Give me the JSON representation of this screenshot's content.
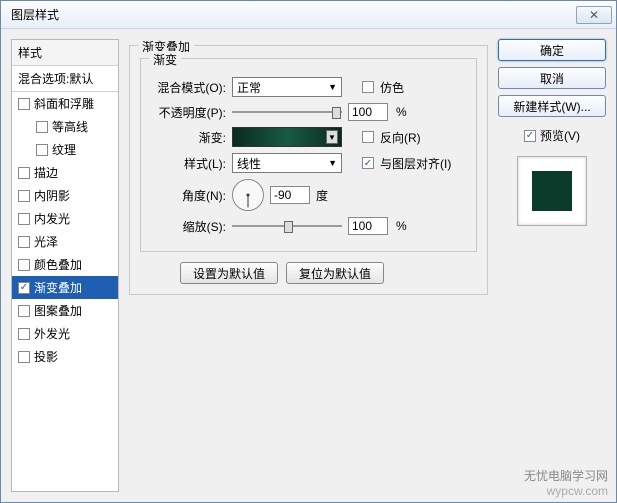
{
  "title": "图层样式",
  "close_glyph": "✕",
  "left": {
    "header": "样式",
    "blending": "混合选项:默认",
    "items": [
      {
        "label": "斜面和浮雕",
        "checked": false,
        "indent": false
      },
      {
        "label": "等高线",
        "checked": false,
        "indent": true
      },
      {
        "label": "纹理",
        "checked": false,
        "indent": true
      },
      {
        "label": "描边",
        "checked": false,
        "indent": false
      },
      {
        "label": "内阴影",
        "checked": false,
        "indent": false
      },
      {
        "label": "内发光",
        "checked": false,
        "indent": false
      },
      {
        "label": "光泽",
        "checked": false,
        "indent": false
      },
      {
        "label": "颜色叠加",
        "checked": false,
        "indent": false
      },
      {
        "label": "渐变叠加",
        "checked": true,
        "indent": false,
        "selected": true
      },
      {
        "label": "图案叠加",
        "checked": false,
        "indent": false
      },
      {
        "label": "外发光",
        "checked": false,
        "indent": false
      },
      {
        "label": "投影",
        "checked": false,
        "indent": false
      }
    ]
  },
  "center": {
    "group_title": "渐变叠加",
    "inner_title": "渐变",
    "blend_mode_label": "混合模式(O):",
    "blend_mode_value": "正常",
    "dither_label": "仿色",
    "opacity_label": "不透明度(P):",
    "opacity_value": "100",
    "gradient_label": "渐变:",
    "reverse_label": "反向(R)",
    "style_label": "样式(L):",
    "style_value": "线性",
    "align_label": "与图层对齐(I)",
    "angle_label": "角度(N):",
    "angle_value": "-90",
    "angle_unit": "度",
    "scale_label": "缩放(S):",
    "scale_value": "100",
    "pct": "%",
    "default_btn": "设置为默认值",
    "reset_btn": "复位为默认值"
  },
  "right": {
    "ok": "确定",
    "cancel": "取消",
    "new_style": "新建样式(W)...",
    "preview_label": "预览(V)"
  },
  "watermark": {
    "line1": "无忧电脑学习网",
    "line2": "wypcw.com"
  }
}
